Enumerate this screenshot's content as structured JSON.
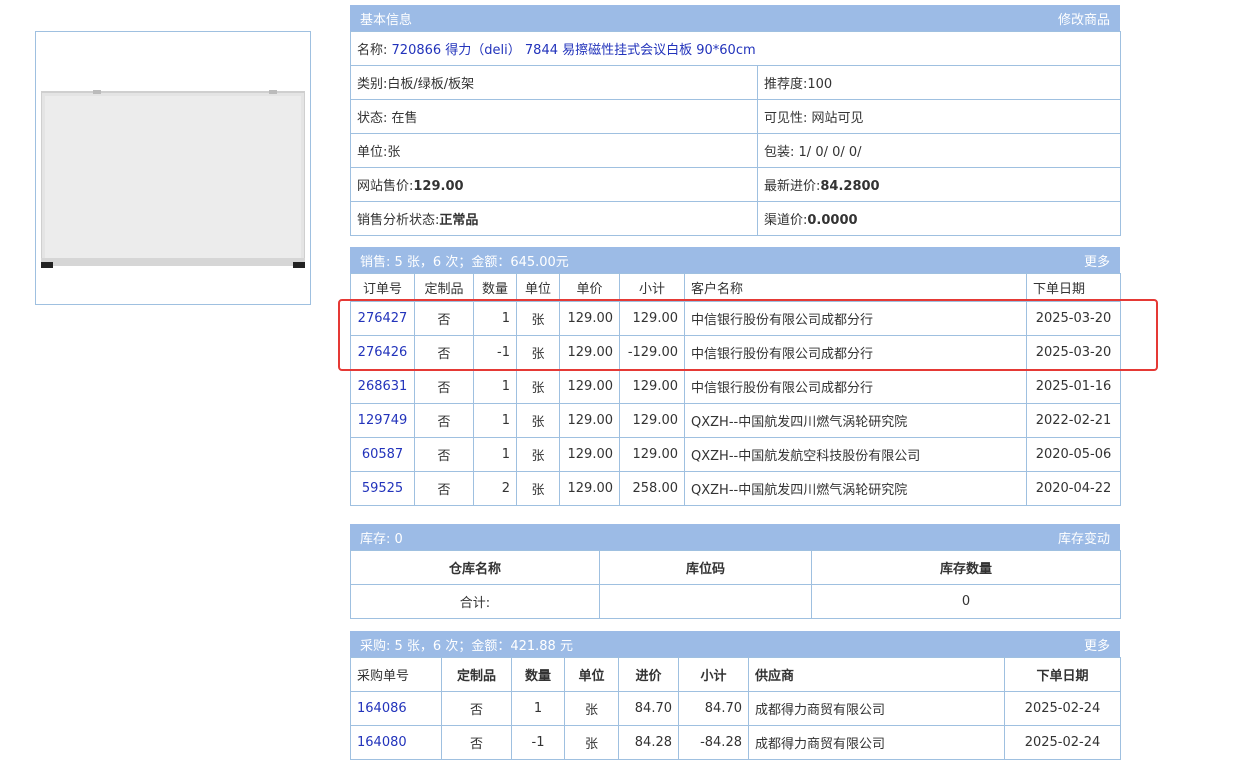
{
  "basic": {
    "header_title": "基本信息",
    "header_action": "修改商品",
    "name_label": "名称:",
    "name_value": "720866 得力（deli） 7844 易擦磁性挂式会议白板 90*60cm",
    "category_label": "类别:",
    "category_value": "白板/绿板/板架",
    "recommend_label": "推荐度:",
    "recommend_value": "100",
    "status_label": "状态:",
    "status_value": "在售",
    "visibility_label": "可见性:",
    "visibility_value": "网站可见",
    "unit_label": "单位:",
    "unit_value": "张",
    "package_label": "包装:",
    "package_value": "1/ 0/ 0/ 0/",
    "site_price_label": "网站售价:",
    "site_price_value": "129.00",
    "latest_cost_label": "最新进价:",
    "latest_cost_value": "84.2800",
    "sales_status_label": "销售分析状态:",
    "sales_status_value": "正常品",
    "channel_price_label": "渠道价:",
    "channel_price_value": "0.0000"
  },
  "sales": {
    "header_title": "销售:  5 张，6 次；金额：645.00元",
    "header_action": "更多",
    "columns": [
      "订单号",
      "定制品",
      "数量",
      "单位",
      "单价",
      "小计",
      "客户名称",
      "下单日期"
    ],
    "rows": [
      {
        "order": "276427",
        "custom": "否",
        "qty": "1",
        "unit": "张",
        "price": "129.00",
        "subtotal": "129.00",
        "customer": "中信银行股份有限公司成都分行",
        "date": "2025-03-20"
      },
      {
        "order": "276426",
        "custom": "否",
        "qty": "-1",
        "unit": "张",
        "price": "129.00",
        "subtotal": "-129.00",
        "customer": "中信银行股份有限公司成都分行",
        "date": "2025-03-20"
      },
      {
        "order": "268631",
        "custom": "否",
        "qty": "1",
        "unit": "张",
        "price": "129.00",
        "subtotal": "129.00",
        "customer": "中信银行股份有限公司成都分行",
        "date": "2025-01-16"
      },
      {
        "order": "129749",
        "custom": "否",
        "qty": "1",
        "unit": "张",
        "price": "129.00",
        "subtotal": "129.00",
        "customer": "QXZH--中国航发四川燃气涡轮研究院",
        "date": "2022-02-21"
      },
      {
        "order": "60587",
        "custom": "否",
        "qty": "1",
        "unit": "张",
        "price": "129.00",
        "subtotal": "129.00",
        "customer": "QXZH--中国航发航空科技股份有限公司",
        "date": "2020-05-06"
      },
      {
        "order": "59525",
        "custom": "否",
        "qty": "2",
        "unit": "张",
        "price": "129.00",
        "subtotal": "258.00",
        "customer": "QXZH--中国航发四川燃气涡轮研究院",
        "date": "2020-04-22"
      }
    ]
  },
  "stock": {
    "header_title": "库存:  0",
    "header_action": "库存变动",
    "columns": [
      "仓库名称",
      "库位码",
      "库存数量"
    ],
    "total_label": "合计:",
    "total_location": "",
    "total_qty": "0"
  },
  "purchase": {
    "header_title": "采购:  5 张，6 次；金额：421.88 元",
    "header_action": "更多",
    "columns": [
      "采购单号",
      "定制品",
      "数量",
      "单位",
      "进价",
      "小计",
      "供应商",
      "下单日期"
    ],
    "rows": [
      {
        "order": "164086",
        "custom": "否",
        "qty": "1",
        "unit": "张",
        "price": "84.70",
        "subtotal": "84.70",
        "supplier": "成都得力商贸有限公司",
        "date": "2025-02-24"
      },
      {
        "order": "164080",
        "custom": "否",
        "qty": "-1",
        "unit": "张",
        "price": "84.28",
        "subtotal": "-84.28",
        "supplier": "成都得力商贸有限公司",
        "date": "2025-02-24"
      }
    ]
  },
  "colors": {
    "header_bg": "#9cbbe6",
    "border": "#9fc0e0",
    "link": "#2233bb",
    "highlight": "#e53935"
  }
}
